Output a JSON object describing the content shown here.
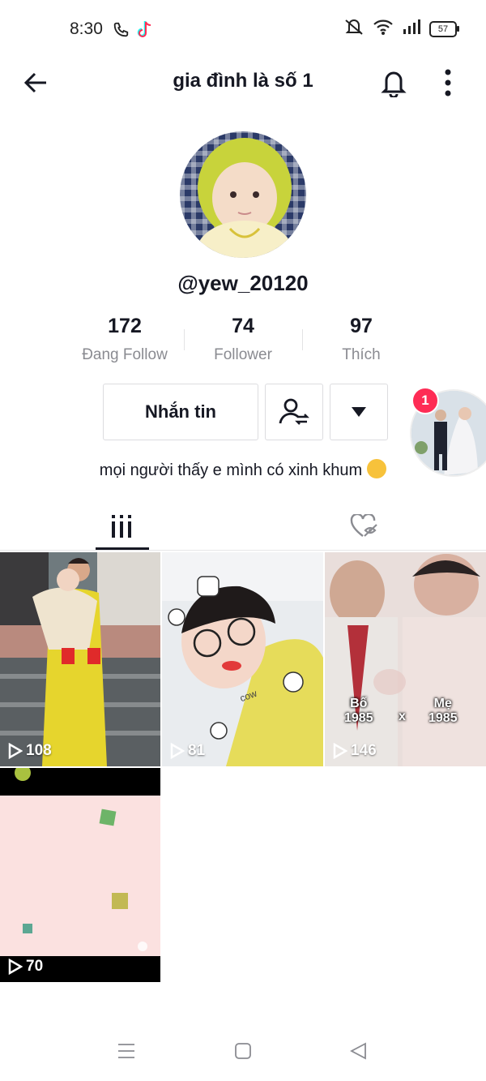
{
  "status_bar": {
    "time": "8:30",
    "battery": "57"
  },
  "header": {
    "title": "gia đình là số 1"
  },
  "profile": {
    "username": "@yew_20120",
    "stats": [
      {
        "value": "172",
        "label": "Đang Follow"
      },
      {
        "value": "74",
        "label": "Follower"
      },
      {
        "value": "97",
        "label": "Thích"
      }
    ],
    "message_button": "Nhắn tin",
    "suggest_badge": "1",
    "bio": "mọi người thấy e mình có xinh khum"
  },
  "videos": [
    {
      "views": "108"
    },
    {
      "views": "81",
      "sticker_text": "cow"
    },
    {
      "views": "146",
      "left_caption": "Bố\n1985",
      "x_mark": "x",
      "right_caption": "Mẹ\n1985"
    },
    {
      "views": "70"
    }
  ],
  "icons": {
    "back": "arrow-left-icon",
    "bell": "bell-icon",
    "more": "more-vertical-icon",
    "friend": "user-switch-icon",
    "dropdown": "triangle-down-icon",
    "grid": "video-grid-icon",
    "liked": "liked-hidden-icon"
  },
  "colors": {
    "accent": "#fe2c55",
    "text": "#161823",
    "muted": "#8a8b91"
  }
}
